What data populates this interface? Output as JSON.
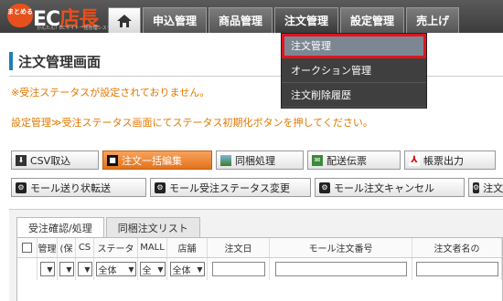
{
  "logo": {
    "badge": "まとめる",
    "main_prefix": "EC",
    "main_suffix": "店長",
    "sub": "かんたん！ECサイト一括管理システム"
  },
  "nav": {
    "tabs": [
      "申込管理",
      "商品管理",
      "注文管理",
      "設定管理",
      "売上げ"
    ],
    "active": "注文管理"
  },
  "dropdown": {
    "items": [
      "注文管理",
      "オークション管理",
      "注文削除履歴"
    ]
  },
  "page": {
    "title": "注文管理画面",
    "msg1": "※受注ステータスが設定されておりません。",
    "msg2": "設定管理≫受注ステータス画面にてステータス初期化ボタンを押してください。"
  },
  "buttons_row1": [
    "CSV取込",
    "注文一括編集",
    "同梱処理",
    "配送伝票",
    "帳票出力"
  ],
  "buttons_row2": [
    "モール送り状転送",
    "モール受注ステータス変更",
    "モール注文キャンセル",
    "注文"
  ],
  "sub_tabs": [
    "受注確認/処理",
    "同梱注文リスト"
  ],
  "grid": {
    "headers": [
      "",
      "管理",
      "(保",
      "CS",
      "ステータ",
      "MALL",
      "店舗",
      "注文日",
      "モール注文番号",
      "注文者名の"
    ],
    "filters": {
      "status": "全体",
      "mall": "全",
      "shop": "全体"
    }
  },
  "colors": {
    "accent": "#e07800",
    "highlight_border": "#e0151d",
    "title_mark": "#1e7fb5"
  }
}
